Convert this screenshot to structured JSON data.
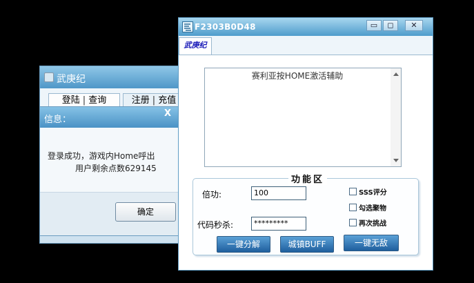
{
  "back_window": {
    "title": "武庚纪",
    "tabs": [
      {
        "a": "登陆",
        "b": "查询"
      },
      {
        "a": "注册",
        "b": "充值"
      }
    ]
  },
  "dialog": {
    "title": "信息：",
    "close": "X",
    "line1": "登录成功，游戏内Home呼出",
    "line2": "用户剩余点数629145",
    "ok_label": "确定"
  },
  "main_window": {
    "title": "F2303B0D48",
    "controls": {
      "min": "▭",
      "max": "◻",
      "close": "✕"
    },
    "tab": "武庚纪",
    "textbox": "赛利亚按HOME激活辅助",
    "group_title": "功能区",
    "fields": {
      "multiplier_label": "倍功:",
      "multiplier_value": "100",
      "code_label": "代码秒杀:",
      "code_value": "*********"
    },
    "checkboxes": [
      "SSS评分",
      "勾选聚物",
      "再次挑战"
    ],
    "buttons": [
      "一键分解",
      "城镇BUFF",
      "一键无敌"
    ]
  }
}
